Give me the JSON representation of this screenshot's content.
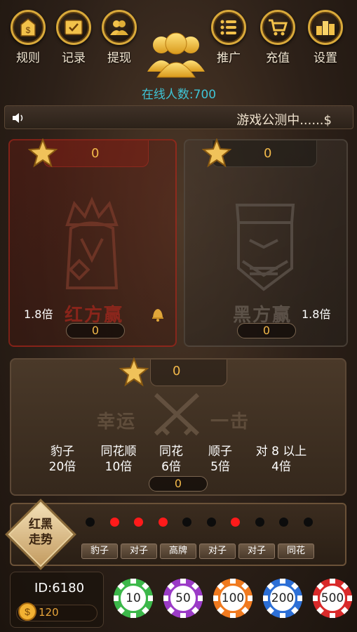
{
  "top_buttons_left": [
    {
      "label": "规则",
      "icon": "rules-icon"
    },
    {
      "label": "记录",
      "icon": "record-icon"
    },
    {
      "label": "提现",
      "icon": "withdraw-icon"
    }
  ],
  "top_buttons_right": [
    {
      "label": "推广",
      "icon": "promote-icon"
    },
    {
      "label": "充值",
      "icon": "cart-icon"
    },
    {
      "label": "设置",
      "icon": "settings-icon"
    }
  ],
  "online": {
    "text": "在线人数:700"
  },
  "marquee": {
    "text": "游戏公测中......$"
  },
  "red_panel": {
    "bet_total": "0",
    "multiplier": "1.8倍",
    "watermark": "红方赢",
    "my_bet": "0"
  },
  "black_panel": {
    "bet_total": "0",
    "multiplier": "1.8倍",
    "watermark": "黑方赢",
    "my_bet": "0"
  },
  "lucky_panel": {
    "bet_total": "0",
    "watermark_left": "幸运",
    "watermark_right": "一击",
    "my_bet": "0",
    "odds": [
      {
        "name": "豹子",
        "mult": "20倍"
      },
      {
        "name": "同花顺",
        "mult": "10倍"
      },
      {
        "name": "同花",
        "mult": "6倍"
      },
      {
        "name": "顺子",
        "mult": "5倍"
      },
      {
        "name": "对 8 以上",
        "mult": "4倍"
      }
    ]
  },
  "trend": {
    "title_line1": "红黑",
    "title_line2": "走势",
    "dots": [
      "black",
      "red",
      "red",
      "red",
      "black",
      "black",
      "red",
      "black",
      "black",
      "black"
    ],
    "results": [
      "豹子",
      "对子",
      "高牌",
      "对子",
      "对子",
      "同花"
    ]
  },
  "player": {
    "id_text": "ID:6180",
    "coins": "120"
  },
  "chips": [
    {
      "value": "10",
      "color": "#3cb84a"
    },
    {
      "value": "50",
      "color": "#9b3bc7"
    },
    {
      "value": "100",
      "color": "#f07a1f"
    },
    {
      "value": "200",
      "color": "#2c6fd6"
    },
    {
      "value": "500",
      "color": "#d92a2a"
    }
  ],
  "colors": {
    "gold": "#f2b94a",
    "online": "#3fc4d6",
    "red_dot": "#ff1a1a",
    "black_dot": "#0c0c0c"
  }
}
